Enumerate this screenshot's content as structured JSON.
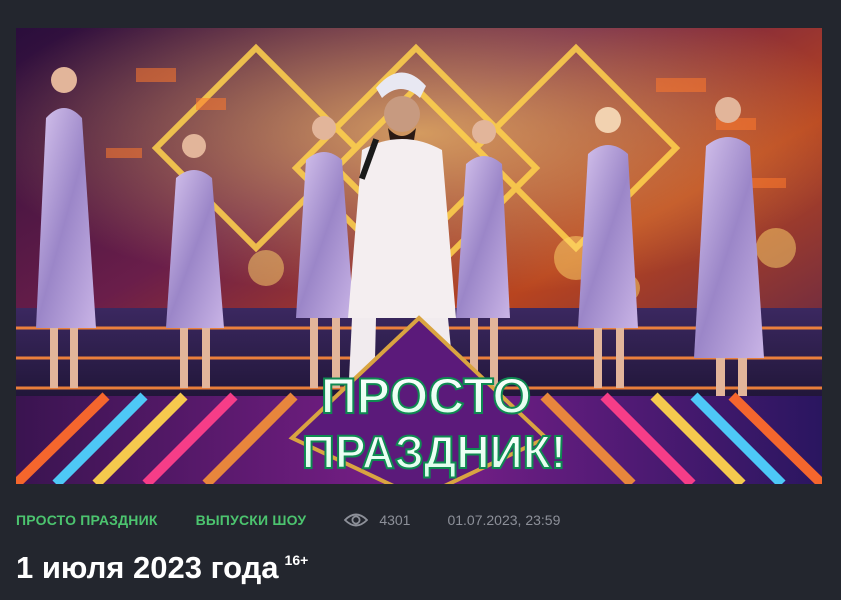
{
  "video": {
    "logo_line1": "ПРОСТО",
    "logo_line2": "ПРАЗДНИК!"
  },
  "meta": {
    "program_link": "ПРОСТО ПРАЗДНИК",
    "category_link": "ВЫПУСКИ ШОУ",
    "views": "4301",
    "date": "01.07.2023, 23:59",
    "view_icon": "eye-icon"
  },
  "episode": {
    "title": "1 июля 2023 года",
    "age_rating": "16+"
  },
  "colors": {
    "background": "#23262e",
    "link_green": "#4cc46f",
    "meta_gray": "#8d9099",
    "title_white": "#ffffff"
  }
}
